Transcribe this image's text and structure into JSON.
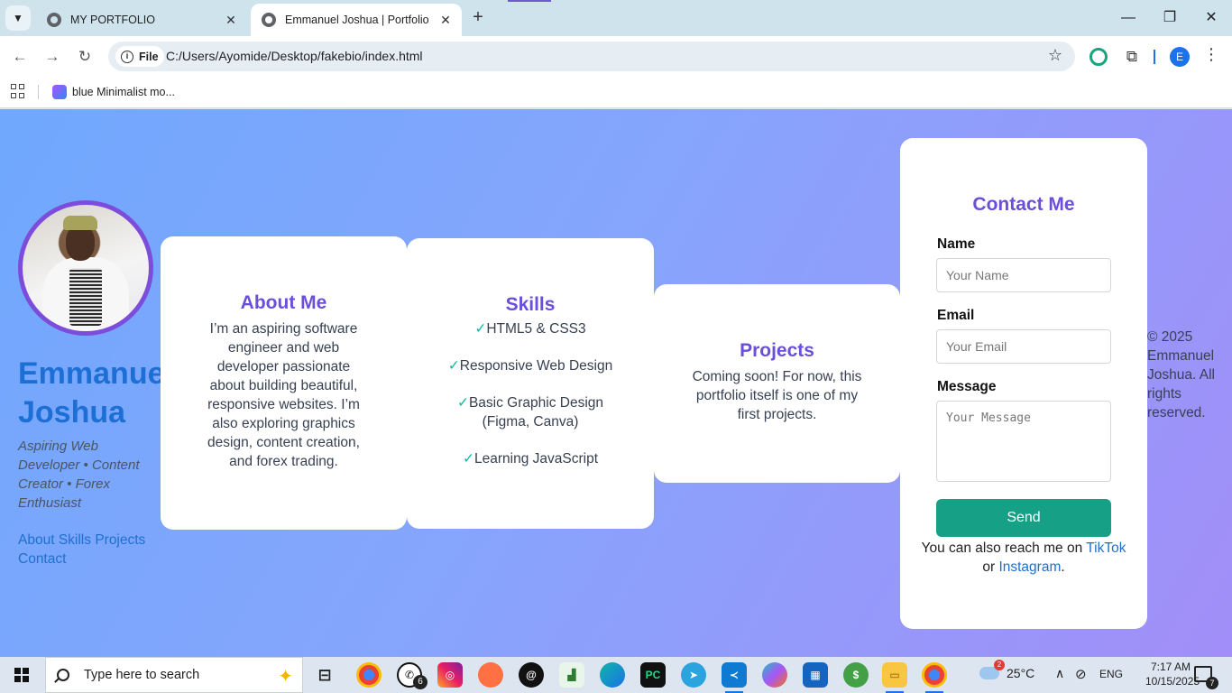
{
  "browser": {
    "tabs": [
      {
        "label": "MY PORTFOLIO",
        "active": false
      },
      {
        "label": "Emmanuel Joshua | Portfolio",
        "active": true
      }
    ],
    "address": {
      "scheme_label": "File",
      "url": "C:/Users/Ayomide/Desktop/fakebio/index.html"
    },
    "profile_initial": "E",
    "bookmarks": [
      {
        "label": "blue Minimalist mo..."
      }
    ]
  },
  "hero": {
    "name": "Emmanuel Joshua",
    "tagline": "Aspiring Web Developer • Content Creator • Forex Enthusiast",
    "nav": [
      "About",
      "Skills",
      "Projects",
      "Contact"
    ]
  },
  "about": {
    "title": "About Me",
    "text": "I’m an aspiring software engineer and web developer passionate about building beautiful, responsive websites. I’m also exploring graphics design, content creation, and forex trading."
  },
  "skills": {
    "title": "Skills",
    "items": [
      "HTML5 & CSS3",
      "Responsive Web Design",
      "Basic Graphic Design (Figma, Canva)",
      "Learning JavaScript"
    ]
  },
  "projects": {
    "title": "Projects",
    "text": "Coming soon! For now, this portfolio itself is one of my first projects."
  },
  "contact": {
    "title": "Contact Me",
    "name_label": "Name",
    "name_placeholder": "Your Name",
    "email_label": "Email",
    "email_placeholder": "Your Email",
    "message_label": "Message",
    "message_placeholder": "Your Message",
    "send_label": "Send",
    "reach_prefix": "You can also reach me on",
    "reach_link1": "TikTok",
    "reach_or": "or",
    "reach_link2": "Instagram",
    "reach_suffix": "."
  },
  "footer": {
    "copyright": "© 2025 Emmanuel Joshua. All rights reserved."
  },
  "taskbar": {
    "search_placeholder": "Type here to search",
    "whatsapp_badge": "6",
    "weather_badge": "2",
    "temperature": "25°C",
    "language": "ENG",
    "time": "7:17 AM",
    "date": "10/15/2025",
    "notification_count": "7"
  },
  "colors": {
    "accent_purple": "#6b4fd8",
    "name_blue": "#1d6fd6",
    "send_green": "#16a085",
    "check_teal": "#14b8a6"
  }
}
